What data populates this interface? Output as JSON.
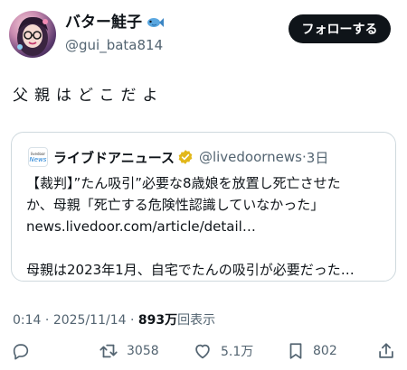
{
  "author": {
    "display_name": "バター鮭子",
    "handle": "@gui_bata814",
    "name_icon": "fish-emoji-icon"
  },
  "follow_button": {
    "label": "フォローする"
  },
  "tweet": {
    "text": "父親はどこだよ"
  },
  "quoted": {
    "logo_small": "livedoor",
    "logo_text": "News",
    "name": "ライブドアニュース",
    "handle": "@livedoornews",
    "separator": "·",
    "time": "3日",
    "line1": "【裁判】”たん吸引”必要な8歳娘を放置し死亡させた",
    "line2": "か、母親「死亡する危険性認識していなかった」",
    "line3": "news.livedoor.com/article/detail…",
    "line4": "母親は2023年1月、自宅でたんの吸引が必要だった…"
  },
  "meta": {
    "time": "0:14",
    "dot": " · ",
    "date": "2025/11/14",
    "views_count": "893万",
    "views_label": "回表示"
  },
  "actions": {
    "retweets": "3058",
    "likes": "5.1万",
    "bookmarks": "802"
  },
  "colors": {
    "text": "#0f1419",
    "secondary": "#536471",
    "border": "#cfd9de",
    "verified_gold": "#e2b719"
  }
}
